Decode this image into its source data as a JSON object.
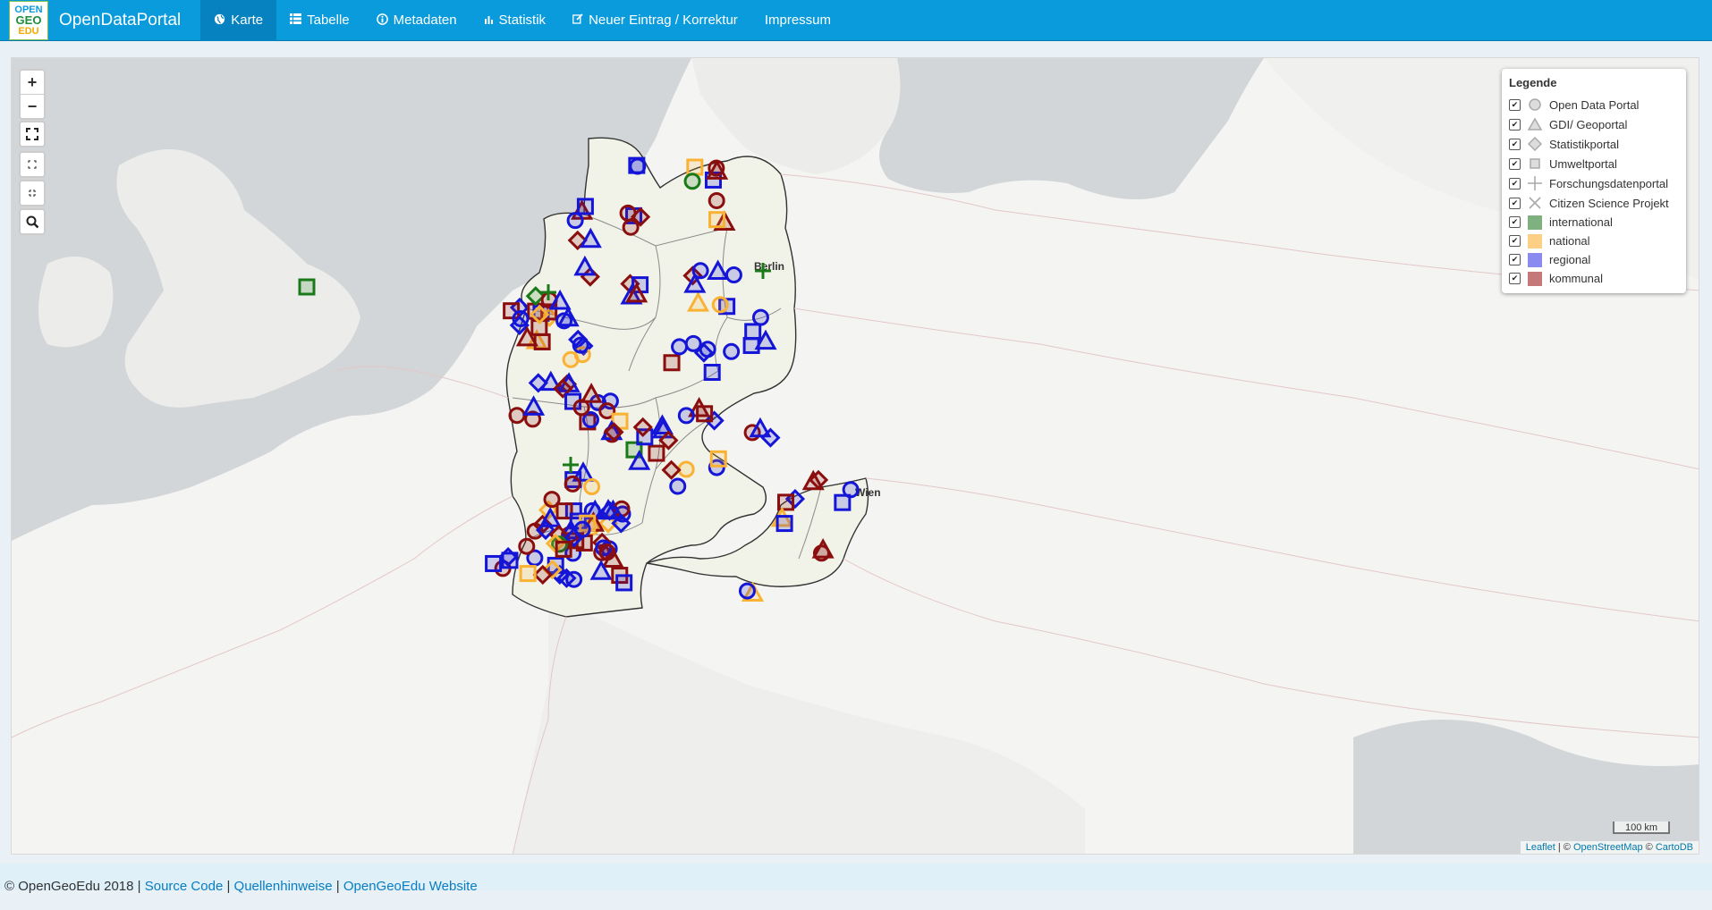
{
  "app": {
    "logo_lines": [
      "OPEN",
      "GEO",
      "EDU"
    ],
    "brand": "OpenDataPortal"
  },
  "nav": [
    {
      "label": "Karte",
      "icon": "globe-icon",
      "active": true
    },
    {
      "label": "Tabelle",
      "icon": "list-icon",
      "active": false
    },
    {
      "label": "Metadaten",
      "icon": "info-icon",
      "active": false
    },
    {
      "label": "Statistik",
      "icon": "bar-chart-icon",
      "active": false
    },
    {
      "label": "Neuer Eintrag / Korrektur",
      "icon": "edit-icon",
      "active": false
    },
    {
      "label": "Impressum",
      "icon": "",
      "active": false
    }
  ],
  "map": {
    "zoom_in": "+",
    "zoom_out": "−",
    "city_labels": [
      "Berlin",
      "Wien"
    ],
    "scale_label": "100 km",
    "attribution": {
      "leaflet": "Leaflet",
      "sep": " | © ",
      "osm": "OpenStreetMap",
      "copy": " © ",
      "carto": "CartoDB"
    },
    "colors": {
      "international": "#1a7a1a",
      "national": "#f9b233",
      "regional": "#1515d8",
      "kommunal": "#8b0e0e"
    }
  },
  "legend": {
    "title": "Legende",
    "types": [
      {
        "label": "Open Data Portal",
        "symbol": "circle",
        "checked": true
      },
      {
        "label": "GDI/ Geoportal",
        "symbol": "triangle",
        "checked": true
      },
      {
        "label": "Statistikportal",
        "symbol": "diamond",
        "checked": true
      },
      {
        "label": "Umweltportal",
        "symbol": "square",
        "checked": true
      },
      {
        "label": "Forschungsdatenportal",
        "symbol": "plus",
        "checked": true
      },
      {
        "label": "Citizen Science Projekt",
        "symbol": "cross",
        "checked": true
      }
    ],
    "levels": [
      {
        "label": "international",
        "color": "#7fb07f",
        "checked": true
      },
      {
        "label": "national",
        "color": "#fbd084",
        "checked": true
      },
      {
        "label": "regional",
        "color": "#8a8af0",
        "checked": true
      },
      {
        "label": "kommunal",
        "color": "#c47878",
        "checked": true
      }
    ]
  },
  "footer": {
    "copyright": "© OpenGeoEdu 2018 | ",
    "source": "Source Code",
    "sep1": " | ",
    "sources": "Quellenhinweise",
    "sep2": " | ",
    "website": "OpenGeoEdu Website"
  }
}
